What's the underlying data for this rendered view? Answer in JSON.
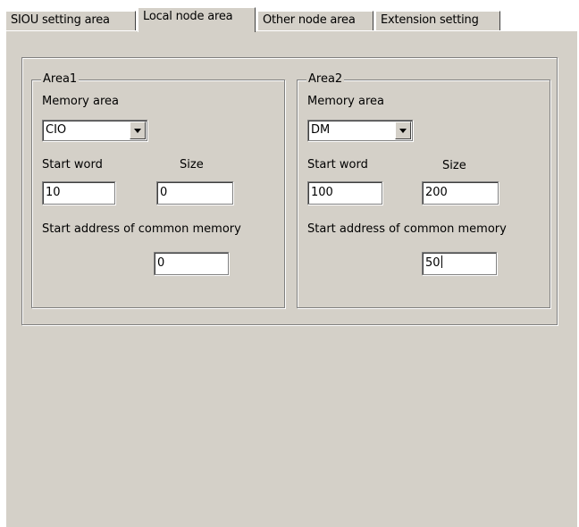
{
  "tabs": [
    {
      "label": "SIOU setting area",
      "active": false
    },
    {
      "label": "Local node area",
      "active": true
    },
    {
      "label": "Other node area",
      "active": false
    },
    {
      "label": "Extension setting",
      "active": false
    }
  ],
  "area1": {
    "title": "Area1",
    "memory_area_label": "Memory area",
    "memory_area_value": "CIO",
    "start_word_label": "Start word",
    "start_word_value": "10",
    "size_label": "Size",
    "size_value": "0",
    "common_memory_label": "Start address of common memory",
    "common_memory_value": "0"
  },
  "area2": {
    "title": "Area2",
    "memory_area_label": "Memory area",
    "memory_area_value": "DM",
    "start_word_label": "Start word",
    "start_word_value": "100",
    "size_label": "Size",
    "size_value": "200",
    "common_memory_label": "Start address of common memory",
    "common_memory_value": "50"
  },
  "icons": {
    "dropdown": "chevron-down-icon"
  },
  "colors": {
    "face": "#d4d0c8",
    "shadow": "#808080",
    "field": "#ffffff"
  }
}
